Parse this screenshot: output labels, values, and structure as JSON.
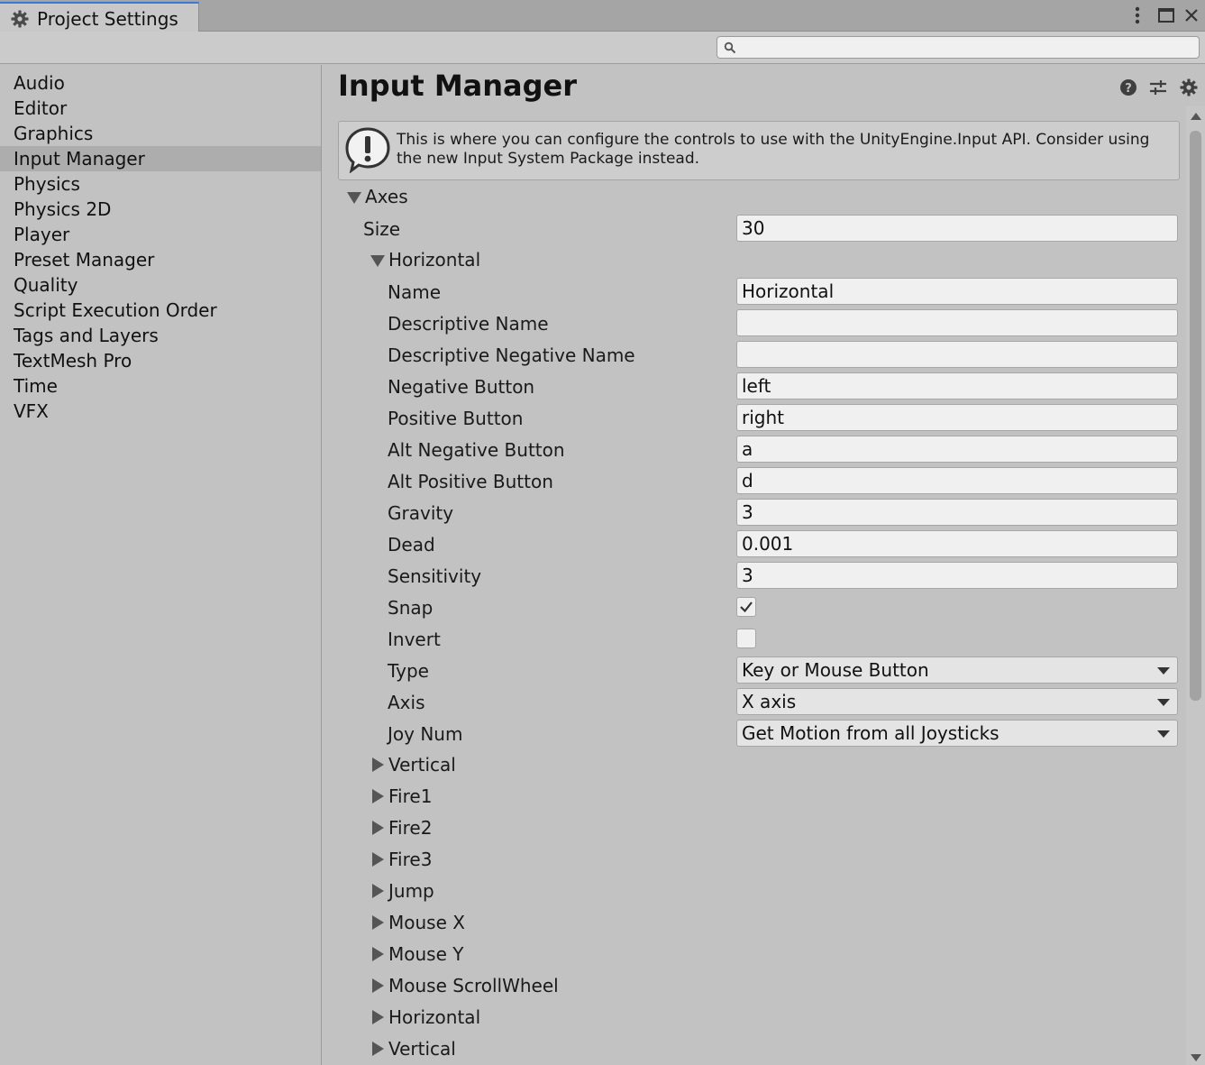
{
  "window": {
    "tab_title": "Project Settings",
    "icons": [
      "gear-icon",
      "more-vertical-icon",
      "maximize-icon",
      "close-icon"
    ]
  },
  "search": {
    "placeholder": "",
    "value": ""
  },
  "sidebar": {
    "items": [
      {
        "label": "Audio",
        "selected": false
      },
      {
        "label": "Editor",
        "selected": false
      },
      {
        "label": "Graphics",
        "selected": false
      },
      {
        "label": "Input Manager",
        "selected": true
      },
      {
        "label": "Physics",
        "selected": false
      },
      {
        "label": "Physics 2D",
        "selected": false
      },
      {
        "label": "Player",
        "selected": false
      },
      {
        "label": "Preset Manager",
        "selected": false
      },
      {
        "label": "Quality",
        "selected": false
      },
      {
        "label": "Script Execution Order",
        "selected": false
      },
      {
        "label": "Tags and Layers",
        "selected": false
      },
      {
        "label": "TextMesh Pro",
        "selected": false
      },
      {
        "label": "Time",
        "selected": false
      },
      {
        "label": "VFX",
        "selected": false
      }
    ]
  },
  "main": {
    "title": "Input Manager",
    "header_icons": [
      "help-icon",
      "preset-sliders-icon",
      "settings-gear-icon"
    ],
    "info_box": {
      "text": "This is where you can configure the controls to use with the UnityEngine.Input API. Consider using the new Input System Package instead."
    },
    "axes": {
      "label": "Axes",
      "expanded": true,
      "size_label": "Size",
      "size_value": "30",
      "horizontal": {
        "label": "Horizontal",
        "expanded": true,
        "fields": [
          {
            "label": "Name",
            "value": "Horizontal"
          },
          {
            "label": "Descriptive Name",
            "value": ""
          },
          {
            "label": "Descriptive Negative Name",
            "value": ""
          },
          {
            "label": "Negative Button",
            "value": "left"
          },
          {
            "label": "Positive Button",
            "value": "right"
          },
          {
            "label": "Alt Negative Button",
            "value": "a"
          },
          {
            "label": "Alt Positive Button",
            "value": "d"
          },
          {
            "label": "Gravity",
            "value": "3"
          },
          {
            "label": "Dead",
            "value": "0.001"
          },
          {
            "label": "Sensitivity",
            "value": "3"
          }
        ],
        "snap": {
          "label": "Snap",
          "checked": true
        },
        "invert": {
          "label": "Invert",
          "checked": false
        },
        "type": {
          "label": "Type",
          "value": "Key or Mouse Button"
        },
        "axis": {
          "label": "Axis",
          "value": "X axis"
        },
        "joy_num": {
          "label": "Joy Num",
          "value": "Get Motion from all Joysticks"
        }
      },
      "collapsed_entries": [
        "Vertical",
        "Fire1",
        "Fire2",
        "Fire3",
        "Jump",
        "Mouse X",
        "Mouse Y",
        "Mouse ScrollWheel",
        "Horizontal",
        "Vertical"
      ]
    }
  },
  "colors": {
    "accent_tab": "#3a79d8",
    "background": "#c2c2c2",
    "selected_item": "#adadad",
    "field_bg": "#f0f0f0"
  }
}
